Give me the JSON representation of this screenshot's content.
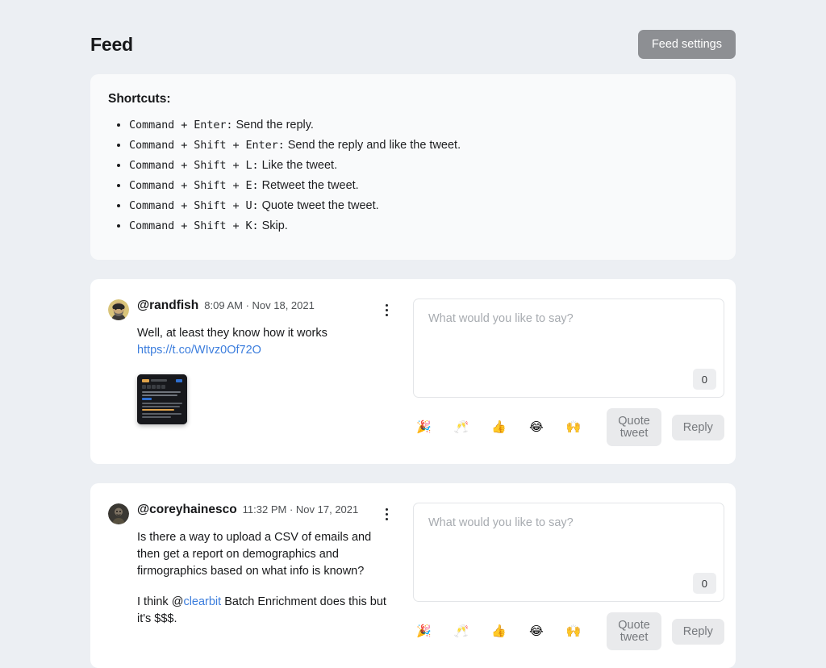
{
  "header": {
    "title": "Feed",
    "settings_button": "Feed settings"
  },
  "shortcuts": {
    "title": "Shortcuts:",
    "items": [
      {
        "keys": "Command + Enter:",
        "desc": "Send the reply."
      },
      {
        "keys": "Command + Shift + Enter:",
        "desc": "Send the reply and like the tweet."
      },
      {
        "keys": "Command + Shift + L:",
        "desc": "Like the tweet."
      },
      {
        "keys": "Command + Shift + E:",
        "desc": "Retweet the tweet."
      },
      {
        "keys": "Command + Shift + U:",
        "desc": "Quote tweet the tweet."
      },
      {
        "keys": "Command + Shift + K:",
        "desc": "Skip."
      }
    ]
  },
  "composer": {
    "placeholder": "What would you like to say?",
    "value": "",
    "char_count": "0",
    "emoji": [
      "🎉",
      "🥂",
      "👍",
      "😂",
      "🙌"
    ],
    "emoji_names": [
      "party-popper",
      "clinking-glasses",
      "thumbs-up",
      "face-with-tears-of-joy",
      "raising-hands"
    ],
    "quote_tweet_label": "Quote tweet",
    "reply_label": "Reply"
  },
  "colors": {
    "page_background": "#eceff3",
    "card_background": "#f9fafb",
    "tweet_card_background": "#ffffff",
    "link": "#3b7ddd",
    "settings_button": "#8d8f93",
    "action_button": "#e9eaec"
  },
  "tweets": [
    {
      "handle": "@randfish",
      "timestamp": "8:09 AM · Nov 18, 2021",
      "line1": "Well, at least they know how it works",
      "link": "https://t.co/WIvz0Of72O",
      "line2": "",
      "has_media": true
    },
    {
      "handle": "@coreyhainesco",
      "timestamp": "11:32 PM · Nov 17, 2021",
      "line1": "Is there a way to upload a CSV of emails and then get a report on demographics and firmographics based on what info is known?",
      "link": "",
      "line2_prefix": "I think @",
      "line2_mention": "clearbit",
      "line2_suffix": " Batch Enrichment does this but it's $$$.",
      "has_media": false
    }
  ]
}
